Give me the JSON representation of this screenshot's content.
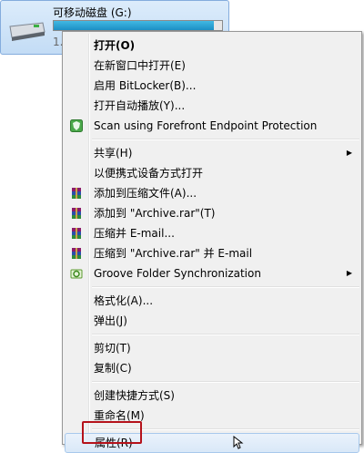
{
  "drive": {
    "name": "可移动磁盘 (G:)",
    "size_text": "1.",
    "usage_fraction": 0.95,
    "icon": "usb-drive-icon"
  },
  "menu": {
    "items": [
      {
        "label": "打开(O)"
      },
      {
        "label": "在新窗口中打开(E)"
      },
      {
        "label": "启用 BitLocker(B)..."
      },
      {
        "label": "打开自动播放(Y)..."
      },
      {
        "label": "Scan using Forefront Endpoint Protection",
        "icon": "forefront-shield-icon"
      },
      {
        "label": "共享(H)"
      },
      {
        "label": "以便携式设备方式打开"
      },
      {
        "label": "添加到压缩文件(A)...",
        "icon": "winrar-icon"
      },
      {
        "label": "添加到 \"Archive.rar\"(T)",
        "icon": "winrar-icon"
      },
      {
        "label": "压缩并 E-mail...",
        "icon": "winrar-icon"
      },
      {
        "label": "压缩到 \"Archive.rar\" 并 E-mail",
        "icon": "winrar-icon"
      },
      {
        "label": "Groove Folder Synchronization",
        "icon": "groove-icon"
      },
      {
        "label": "格式化(A)..."
      },
      {
        "label": "弹出(J)"
      },
      {
        "label": "剪切(T)"
      },
      {
        "label": "复制(C)"
      },
      {
        "label": "创建快捷方式(S)"
      },
      {
        "label": "重命名(M)"
      },
      {
        "label": "属性(R)"
      }
    ]
  },
  "colors": {
    "highlight_border": "#b5121b",
    "bar_fill": "#1c8fc4"
  }
}
